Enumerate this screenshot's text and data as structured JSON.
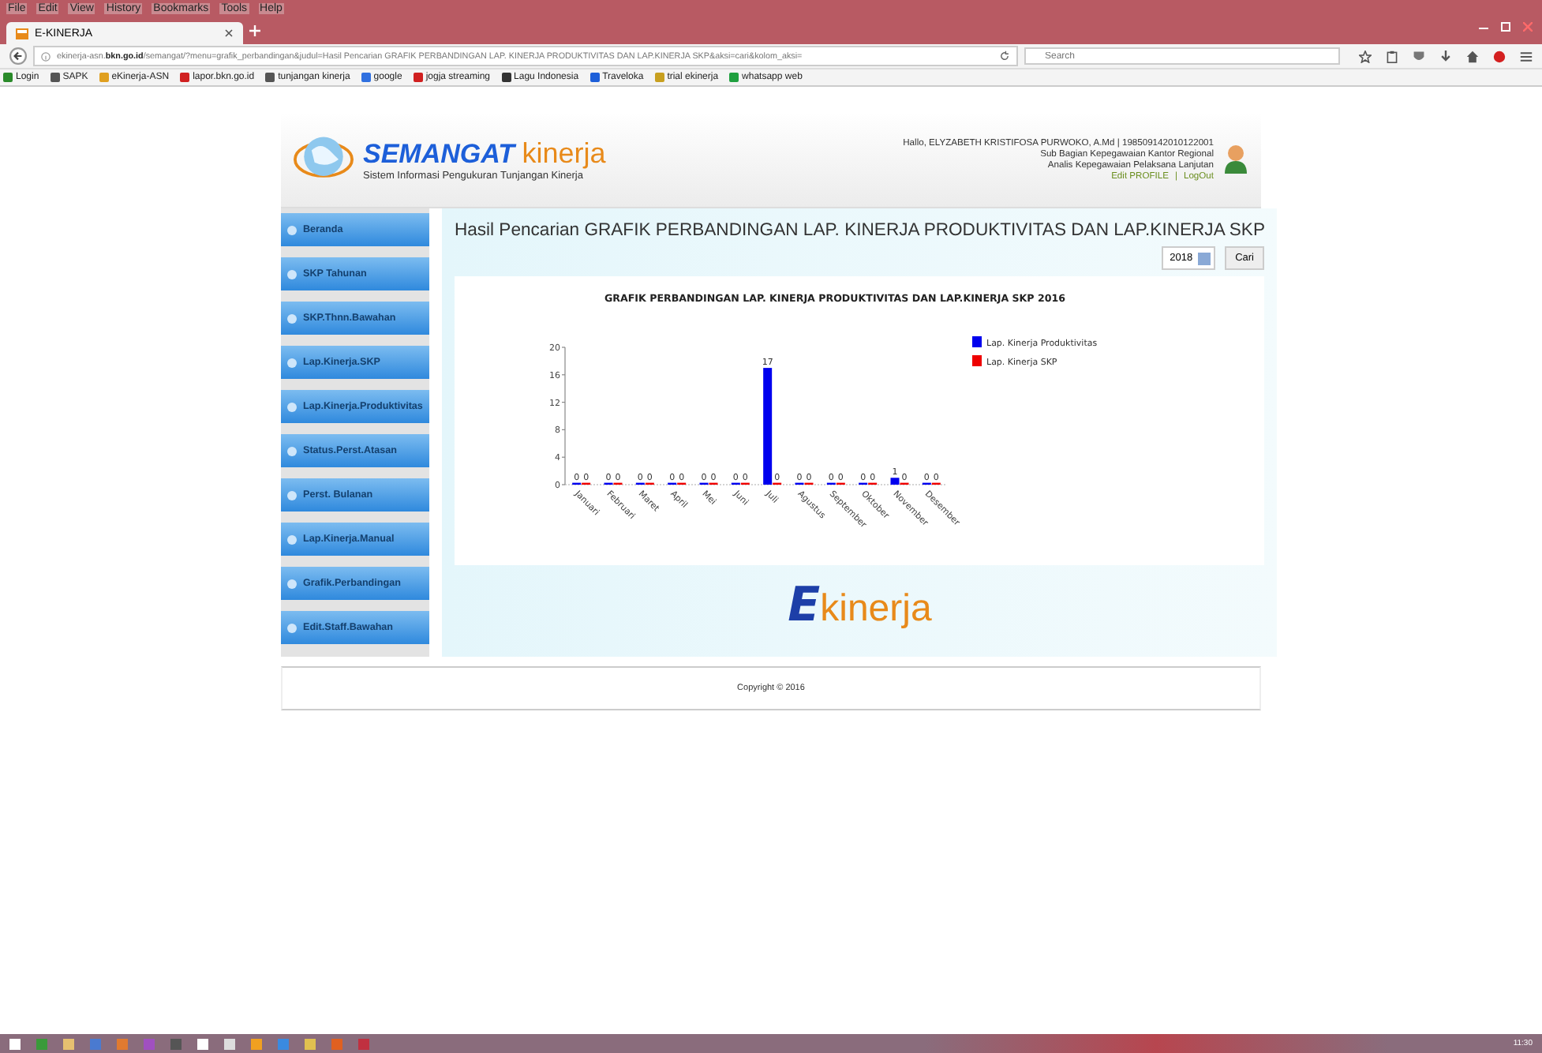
{
  "browser": {
    "menu": [
      "File",
      "Edit",
      "View",
      "History",
      "Bookmarks",
      "Tools",
      "Help"
    ],
    "tabs": [
      {
        "title": "E-KINERJA",
        "selected": true
      }
    ],
    "url": "ekinerja-asn.**bkn.go.id**/semangat/?menu=grafik_perbandingan&judul=Hasil Pencarian GRAFIK PERBANDINGAN LAP. KINERJA PRODUKTIVITAS DAN LAP.KINERJA SKP&aksi=cari&kolom_aksi=",
    "search": {
      "placeholder": "Search"
    },
    "bookmarks": [
      "Login",
      "SAPK",
      "eKinerja-ASN",
      "lapor.bkn.go.id",
      "tunjangan kinerja",
      "google",
      "jogja streaming",
      "Lagu Indonesia",
      "Traveloka",
      "trial ekinerja",
      "whatsapp web"
    ]
  },
  "header": {
    "logo_main": "SEMANGAT",
    "logo_accent": "kinerja",
    "tagline": "Sistem Informasi Pengukuran Tunjangan Kinerja",
    "user_lines": [
      "Hallo, ELYZABETH KRISTIFOSA PURWOKO, A.Md | 198509142010122001",
      "Sub Bagian Kepegawaian Kantor Regional",
      "Analis Kepegawaian Pelaksana Lanjutan"
    ],
    "links": [
      "Edit PROFILE",
      "LogOut"
    ],
    "separator": "|"
  },
  "sidebar": {
    "items": [
      "Beranda",
      "SKP Tahunan",
      "SKP.Thnn.Bawahan",
      "Lap.Kinerja.SKP",
      "Lap.Kinerja.Produktivitas",
      "Status.Perst.Atasan",
      "Perst. Bulanan",
      "Lap.Kinerja.Manual",
      "Grafik.Perbandingan",
      "Edit.Staff.Bawahan"
    ]
  },
  "content": {
    "title": "Hasil Pencarian GRAFIK PERBANDINGAN LAP. KINERJA PRODUKTIVITAS DAN LAP.KINERJA SKP",
    "year": "2018",
    "search_button": "Cari",
    "chart_data": {
      "type": "bar",
      "title": "GRAFIK PERBANDINGAN LAP. KINERJA PRODUKTIVITAS DAN LAP.KINERJA SKP 2016",
      "categories": [
        "Januari",
        "Februari",
        "Maret",
        "April",
        "Mei",
        "Juni",
        "Juli",
        "Agustus",
        "September",
        "Oktober",
        "November",
        "Desember"
      ],
      "series": [
        {
          "name": "Lap. Kinerja Produktivitas",
          "color": "#0000ee",
          "values": [
            0,
            0,
            0,
            0,
            0,
            0,
            17,
            0,
            0,
            0,
            1,
            0
          ]
        },
        {
          "name": "Lap. Kinerja SKP",
          "color": "#ee0000",
          "values": [
            0,
            0,
            0,
            0,
            0,
            0,
            0,
            0,
            0,
            0,
            0,
            0
          ]
        }
      ],
      "ylim": [
        0,
        20
      ],
      "yticks": [
        0,
        4,
        8,
        12,
        16,
        20
      ],
      "data_labels": true,
      "legend": "right"
    },
    "footer_logo_letter": "E",
    "footer_logo_word": "kinerja"
  },
  "footer": {
    "copyright": "Copyright © 2016"
  },
  "taskbar": {
    "clock": "11:30"
  }
}
